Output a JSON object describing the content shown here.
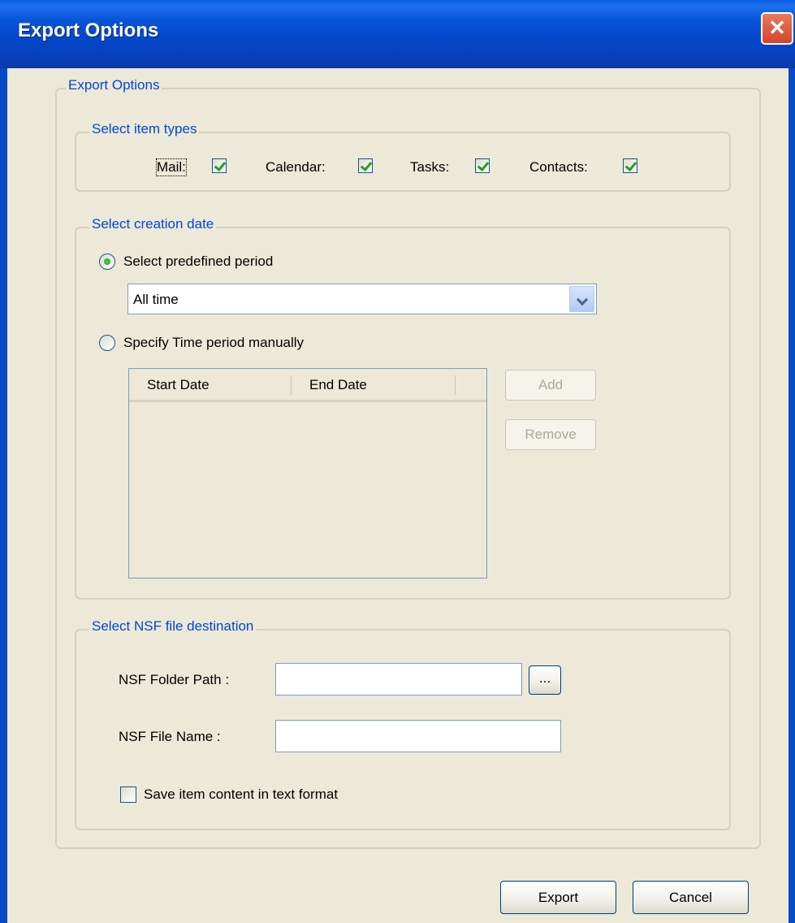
{
  "window": {
    "title": "Export Options",
    "close_glyph": "✕"
  },
  "export_group": {
    "legend": "Export Options"
  },
  "item_types": {
    "legend": "Select item types",
    "items": [
      {
        "label": "Mail:",
        "checked": true
      },
      {
        "label": "Calendar:",
        "checked": true
      },
      {
        "label": "Tasks:",
        "checked": true
      },
      {
        "label": "Contacts:",
        "checked": true
      }
    ]
  },
  "creation_date": {
    "legend": "Select creation date",
    "predefined_label": "Select predefined period",
    "predefined_selected": true,
    "period_value": "All time",
    "manual_label": "Specify Time period manually",
    "manual_selected": false,
    "columns": [
      "Start Date",
      "End Date"
    ],
    "add_label": "Add",
    "remove_label": "Remove"
  },
  "destination": {
    "legend": "Select NSF file destination",
    "folder_label": "NSF Folder Path :",
    "folder_value": "",
    "browse_label": "...",
    "file_label": "NSF File Name :",
    "file_value": "",
    "text_format_label": "Save item content in text format",
    "text_format_checked": false
  },
  "footer": {
    "export_label": "Export",
    "cancel_label": "Cancel"
  },
  "icons": {
    "close": "close-icon",
    "dropdown": "chevron-down-icon"
  }
}
